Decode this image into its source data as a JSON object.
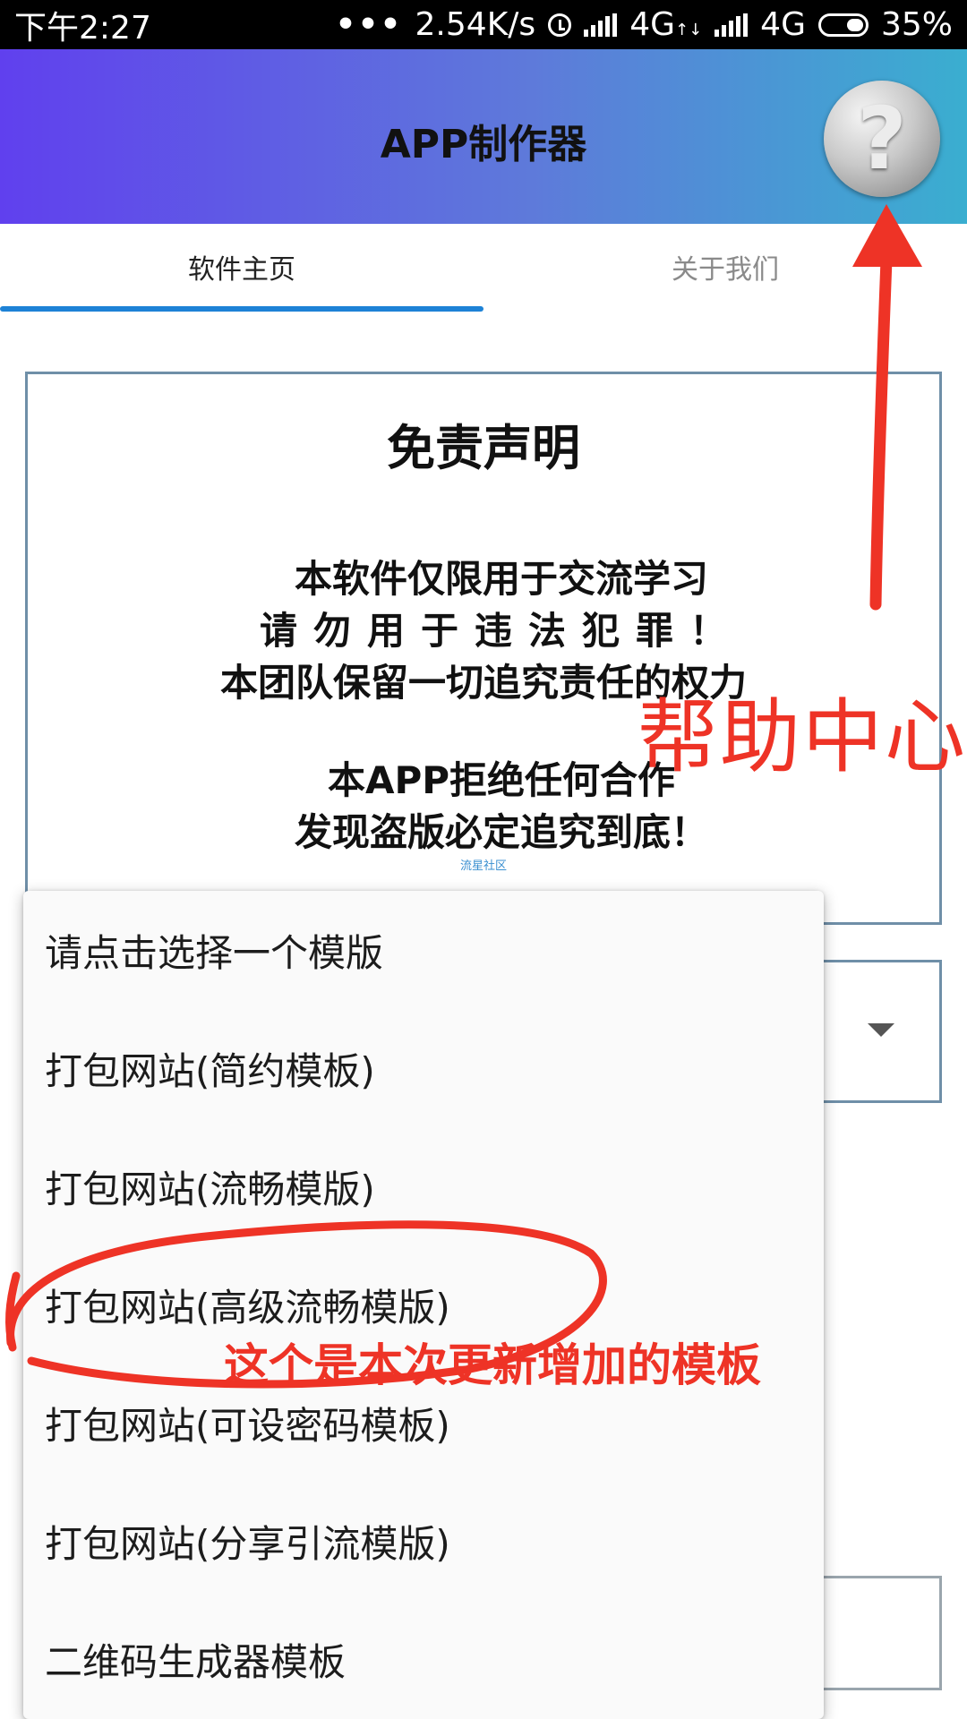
{
  "status_bar": {
    "time": "下午2:27",
    "dots": "•••",
    "speed": "2.54K/s",
    "net1": "4G",
    "net1_sub": "↑↓",
    "net2": "4G",
    "battery": "35%"
  },
  "app_bar": {
    "title": "APP制作器",
    "help_icon": "question-mark-icon",
    "help_glyph": "?"
  },
  "tabs": [
    {
      "label": "软件主页",
      "active": true
    },
    {
      "label": "关于我们",
      "active": false
    }
  ],
  "disclaimer": {
    "title": "免责声明",
    "lines": [
      "本软件仅限用于交流学习",
      "请勿用于违法犯罪！",
      "本团队保留一切追究责任的权力",
      "本APP拒绝任何合作",
      "发现盗版必定追究到底！"
    ],
    "small_text": "流星社区"
  },
  "template_menu": {
    "items": [
      "请点击选择一个模版",
      "打包网站(简约模板)",
      "打包网站(流畅模版)",
      "打包网站(高级流畅模版)",
      "打包网站(可设密码模板)",
      "打包网站(分享引流模版)",
      "二维码生成器模板"
    ]
  },
  "annotations": {
    "help_center": "帮助中心",
    "new_template_note": "这个是本次更新增加的模板",
    "color": "#ee3326"
  },
  "colors": {
    "tab_indicator": "#1d82d6",
    "appbar_gradient_start": "#6040ee",
    "appbar_gradient_end": "#3aaed0"
  }
}
